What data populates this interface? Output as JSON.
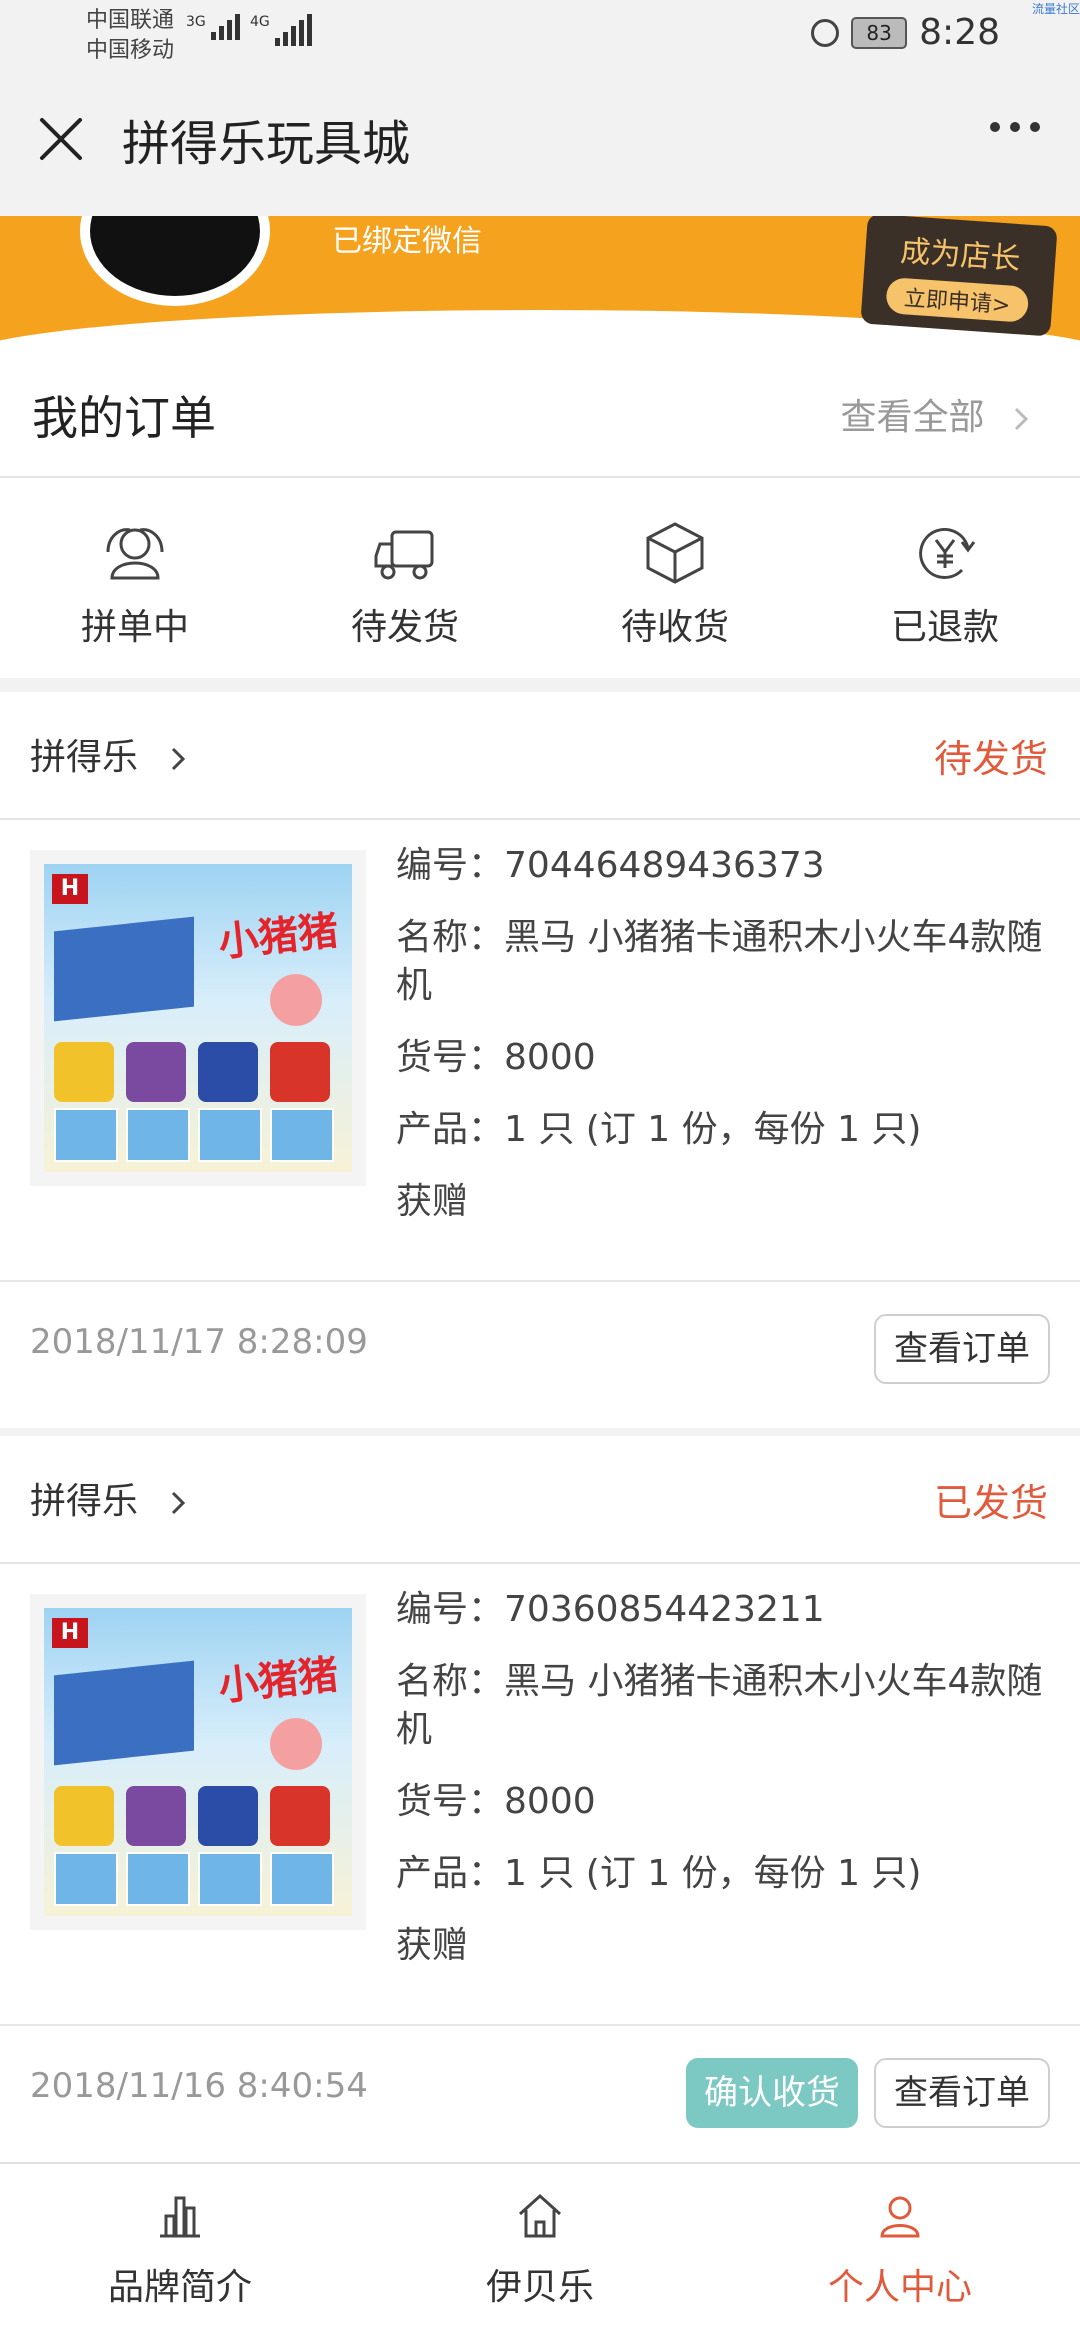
{
  "status_bar": {
    "carrier1": "中国联通",
    "carrier2": "中国移动",
    "net1": "3G",
    "net2": "4G",
    "battery": "83",
    "time": "8:28",
    "corner_text": "流量社区"
  },
  "header": {
    "title": "拼得乐玩具城"
  },
  "profile": {
    "bound_text": "已绑定微信",
    "shop_title": "成为店长",
    "shop_button": "立即申请>"
  },
  "orders_section": {
    "title": "我的订单",
    "view_all": "查看全部"
  },
  "order_status_tabs": [
    {
      "label": "拼单中",
      "icon": "group-icon"
    },
    {
      "label": "待发货",
      "icon": "truck-icon"
    },
    {
      "label": "待收货",
      "icon": "package-icon"
    },
    {
      "label": "已退款",
      "icon": "refund-icon"
    }
  ],
  "orders": [
    {
      "shop": "拼得乐",
      "status": "待发货",
      "image_brand": "小猪猪",
      "number_label": "编号：",
      "number": "70446489436373",
      "name_label": "名称：",
      "name": "黑马 小猪猪卡通积木小火车4款随机",
      "sku_label": "货号：",
      "sku": "8000",
      "product_label": "产品：",
      "product": "1 只 (订 1 份，每份 1 只)",
      "gift": "获赠",
      "datetime": "2018/11/17 8:28:09",
      "view_button": "查看订单"
    },
    {
      "shop": "拼得乐",
      "status": "已发货",
      "image_brand": "小猪猪",
      "number_label": "编号：",
      "number": "70360854423211",
      "name_label": "名称：",
      "name": "黑马 小猪猪卡通积木小火车4款随机",
      "sku_label": "货号：",
      "sku": "8000",
      "product_label": "产品：",
      "product": "1 只 (订 1 份，每份 1 只)",
      "gift": "获赠",
      "datetime": "2018/11/16 8:40:54",
      "confirm_button": "确认收货",
      "view_button": "查看订单"
    }
  ],
  "bottom_nav": [
    {
      "label": "品牌简介",
      "icon": "chart-icon"
    },
    {
      "label": "伊贝乐",
      "icon": "home-icon"
    },
    {
      "label": "个人中心",
      "icon": "person-icon",
      "active": true
    }
  ],
  "colors": {
    "accent_red": "#e05a3c",
    "banner_orange": "#f5a21f",
    "confirm_teal": "#7cc9c3"
  }
}
